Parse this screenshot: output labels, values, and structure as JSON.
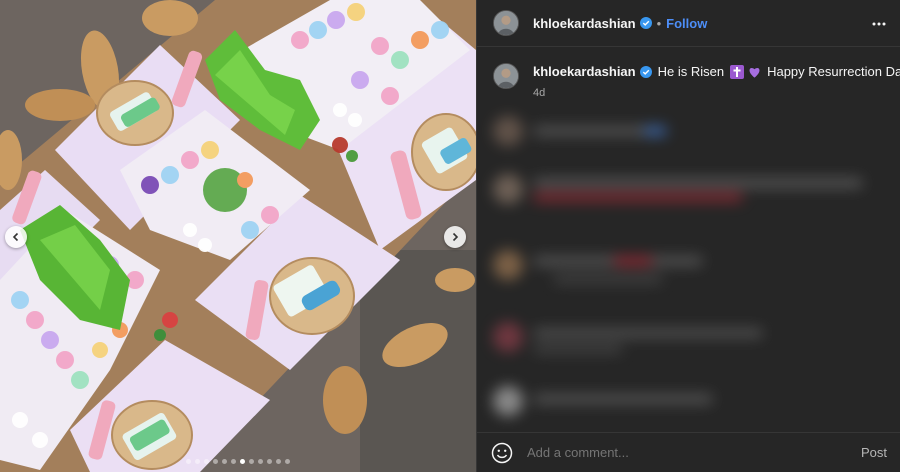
{
  "header": {
    "username": "khloekardashian",
    "separator": "•",
    "follow_label": "Follow",
    "more_icon": "more-horizontal-icon"
  },
  "caption": {
    "username": "khloekardashian",
    "text_start": "He is Risen",
    "text_end": "Happy Resurrection Day",
    "timestamp": "4d"
  },
  "composer": {
    "placeholder": "Add a comment...",
    "post_label": "Post"
  },
  "media": {
    "carousel_total": 12,
    "carousel_active_index": 6
  },
  "colors": {
    "background": "#262626",
    "link": "#4d8ef7",
    "verified": "#3897f0"
  }
}
